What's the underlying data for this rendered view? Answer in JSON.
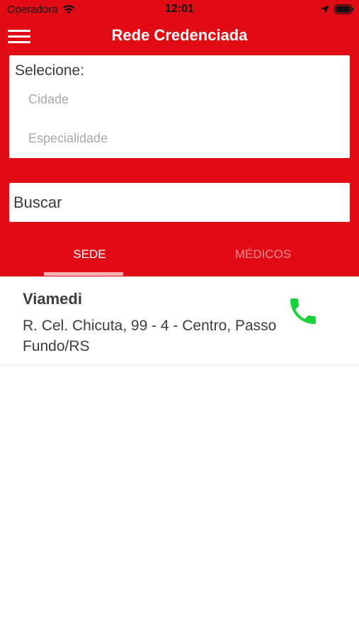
{
  "status_bar": {
    "carrier": "Operadora",
    "time": "12:01"
  },
  "nav": {
    "title": "Rede Credenciada",
    "menu_icon": "hamburger-menu-icon"
  },
  "filters": {
    "label": "Selecione:",
    "city_placeholder": "Cidade",
    "specialty_placeholder": "Especialidade"
  },
  "search": {
    "value": "Buscar"
  },
  "tabs": [
    {
      "label": "SEDE",
      "active": true
    },
    {
      "label": "MÉDICOS",
      "active": false
    }
  ],
  "results": [
    {
      "name": "Viamedi",
      "address": "R. Cel. Chicuta, 99 - 4 - Centro, Passo Fundo/RS",
      "action_icon": "phone-icon"
    }
  ],
  "colors": {
    "brand_red": "#e00b14",
    "phone_green": "#19d23b",
    "inactive_tab": "#ff8f93",
    "tab_indicator": "#f6b4b6"
  }
}
